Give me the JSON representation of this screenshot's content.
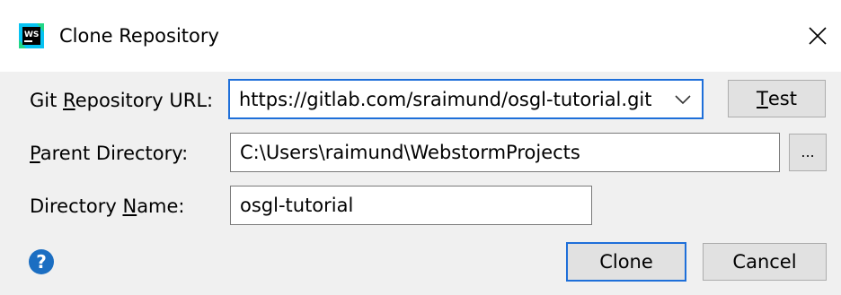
{
  "window": {
    "title": "Clone Repository",
    "app_icon": "webstorm-ws-icon",
    "close_symbol": "close-x-icon"
  },
  "form": {
    "git_url": {
      "label_before": "Git ",
      "label_mnemonic": "R",
      "label_after": "epository URL:",
      "value": "https://gitlab.com/sraimund/osgl-tutorial.git"
    },
    "parent_dir": {
      "label_before": "",
      "label_mnemonic": "P",
      "label_after": "arent Directory:",
      "value": "C:\\Users\\raimund\\WebstormProjects",
      "browse_label": "..."
    },
    "dir_name": {
      "label_before": "Directory ",
      "label_mnemonic": "N",
      "label_after": "ame:",
      "value": "osgl-tutorial"
    }
  },
  "buttons": {
    "test_mnemonic": "T",
    "test_rest": "est",
    "clone": "Clone",
    "cancel": "Cancel",
    "help": "?"
  },
  "colors": {
    "focus_border": "#1e6fd9",
    "help_icon": "#1b6ec2",
    "dialog_bg": "#f0f0f0"
  }
}
